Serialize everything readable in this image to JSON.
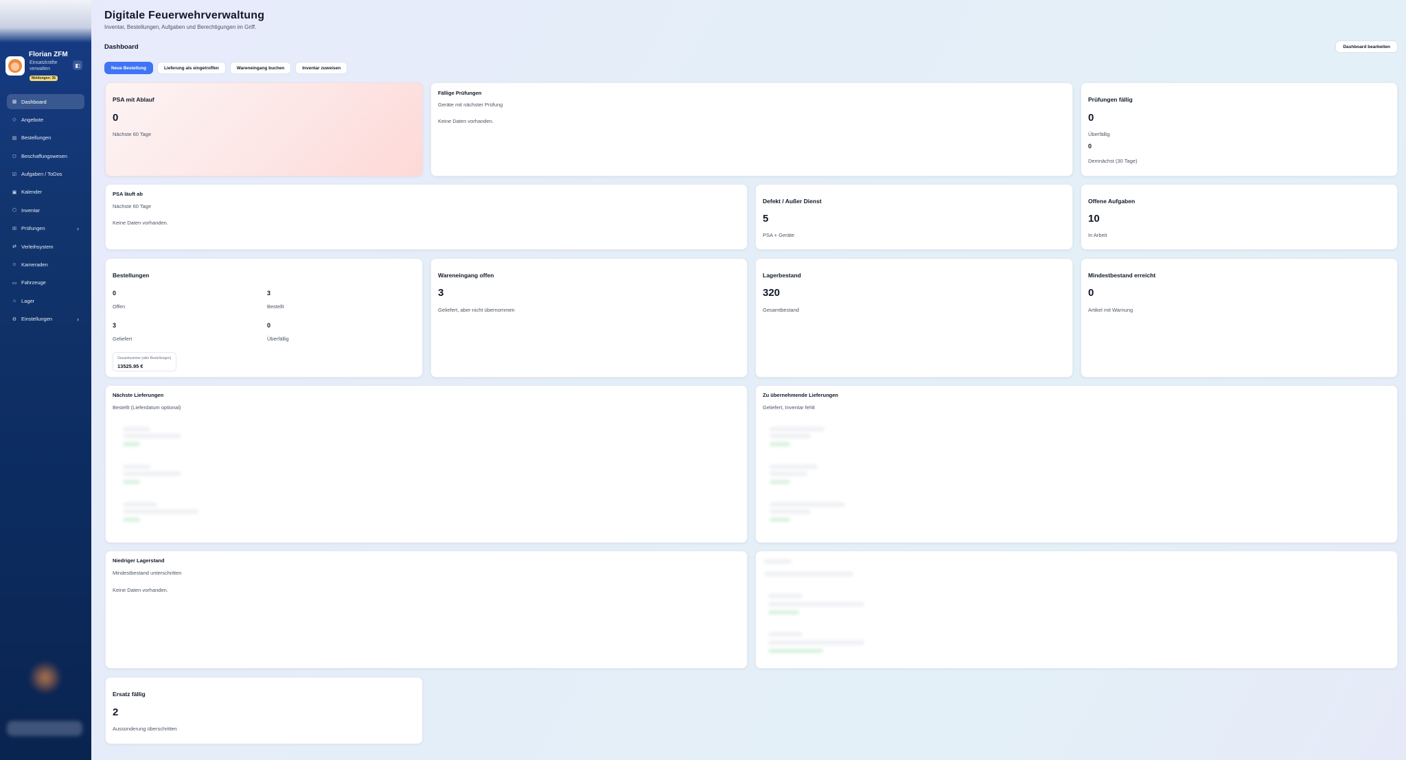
{
  "sidebar": {
    "profile": {
      "name": "Florian ZFM",
      "role": "Einsatzkräfte verwalten",
      "badge": "Meldungen: 36"
    },
    "items": [
      {
        "label": "Dashboard",
        "icon": "dashboard-icon",
        "active": true
      },
      {
        "label": "Angebote",
        "icon": "tag-icon"
      },
      {
        "label": "Bestellungen",
        "icon": "clipboard-icon"
      },
      {
        "label": "Beschaffungswesen",
        "icon": "box-icon"
      },
      {
        "label": "Aufgaben / ToDos",
        "icon": "checklist-icon"
      },
      {
        "label": "Kalender",
        "icon": "calendar-icon"
      },
      {
        "label": "Inventar",
        "icon": "package-icon"
      },
      {
        "label": "Prüfungen",
        "icon": "check-icon",
        "expandable": true
      },
      {
        "label": "Verleihsystem",
        "icon": "swap-icon"
      },
      {
        "label": "Kameraden",
        "icon": "users-icon"
      },
      {
        "label": "Fahrzeuge",
        "icon": "truck-icon"
      },
      {
        "label": "Lager",
        "icon": "warehouse-icon"
      },
      {
        "label": "Einstellungen",
        "icon": "gear-icon",
        "expandable": true
      }
    ]
  },
  "header": {
    "title": "Digitale Feuerwehrverwaltung",
    "subtitle": "Inventar, Bestellungen, Aufgaben und Berechtigungen im Griff.",
    "section": "Dashboard",
    "edit_button": "Dashboard bearbeiten"
  },
  "quick_actions": [
    "Neue Bestellung",
    "Lieferung als eingetroffen",
    "Wareneingang buchen",
    "Inventar zuweisen"
  ],
  "cards": {
    "psa_ablauf": {
      "title": "PSA mit Ablauf",
      "value": "0",
      "text": "Nächste 60 Tage"
    },
    "faellige_pruefungen": {
      "title": "Fällige Prüfungen",
      "subtitle": "Geräte mit nächster Prüfung",
      "empty": "Keine Daten vorhanden."
    },
    "pruefungen_faellig": {
      "title": "Prüfungen fällig",
      "value1": "0",
      "label1": "Überfällig",
      "value2": "0",
      "label2": "Demnächst (30 Tage)"
    },
    "psa_laeuft_ab": {
      "title": "PSA läuft ab",
      "subtitle": "Nächste 60 Tage",
      "empty": "Keine Daten vorhanden."
    },
    "defekt": {
      "title": "Defekt / Außer Dienst",
      "value": "5",
      "text": "PSA + Geräte"
    },
    "offene_aufgaben": {
      "title": "Offene Aufgaben",
      "value": "10",
      "text": "In Arbeit"
    },
    "bestellungen": {
      "title": "Bestellungen",
      "stats": [
        {
          "value": "0",
          "label": "Offen"
        },
        {
          "value": "3",
          "label": "Bestellt"
        },
        {
          "value": "3",
          "label": "Geliefert"
        },
        {
          "value": "0",
          "label": "Überfällig"
        }
      ],
      "total_label": "Gesamtsumme (aller Bestellungen)",
      "total_value": "13525.95 €"
    },
    "wareneingang": {
      "title": "Wareneingang offen",
      "value": "3",
      "text": "Geliefert, aber nicht übernommen"
    },
    "lagerbestand": {
      "title": "Lagerbestand",
      "value": "320",
      "text": "Gesamtbestand"
    },
    "mindestbestand": {
      "title": "Mindestbestand erreicht",
      "value": "0",
      "text": "Artikel mit Warnung"
    },
    "naechste_lieferungen": {
      "title": "Nächste Lieferungen",
      "subtitle": "Bestellt (Lieferdatum optional)"
    },
    "zu_uebernehmende": {
      "title": "Zu übernehmende Lieferungen",
      "subtitle": "Geliefert, Inventar fehlt"
    },
    "niedriger_lagerstand": {
      "title": "Niedriger Lagerstand",
      "subtitle": "Mindestbestand unterschritten",
      "empty": "Keine Daten vorhanden."
    },
    "ersatz": {
      "title": "Ersatz fällig",
      "value": "2",
      "text": "Aussonderung überschritten"
    }
  },
  "colors": {
    "accent": "#3f74f5",
    "sidebar": "#12356f",
    "warning_card": "#fde6e6"
  }
}
